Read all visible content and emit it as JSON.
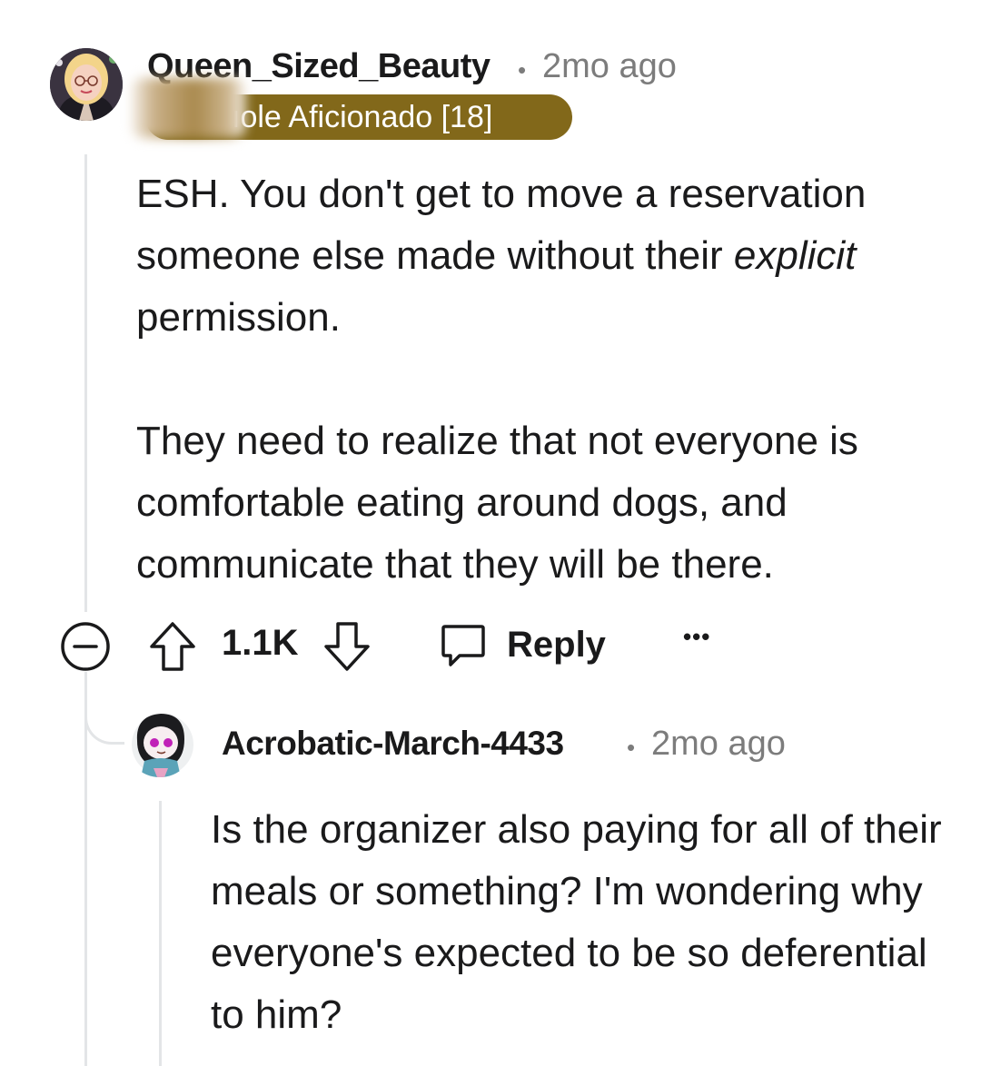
{
  "comments": [
    {
      "username": "Queen_Sized_Beauty",
      "separator": "•",
      "timestamp": "2mo ago",
      "flair": "ıole Aficionado [18]",
      "body": {
        "p1_a": "ESH. You don't get to move a reservation someone else made without their ",
        "p1_em": "explicit",
        "p1_b": " permission.",
        "p2": "They need to realize that not everyone is comfortable eating around dogs, and communicate that they will be there."
      },
      "actions": {
        "vote_count": "1.1K",
        "reply_label": "Reply",
        "more_label": "•••"
      }
    },
    {
      "username": "Acrobatic-March-4433",
      "separator": "•",
      "timestamp": "2mo ago",
      "body": {
        "p1": "Is the organizer also paying for all of their meals or something? I'm wondering why everyone's expected to be so deferential to him?"
      }
    }
  ],
  "icons": {
    "collapse": "collapse-icon",
    "upvote": "upvote-arrow-icon",
    "downvote": "downvote-arrow-icon",
    "reply": "chat-bubble-icon",
    "more": "more-options-icon"
  },
  "colors": {
    "flair_bg": "#82681a",
    "flair_text": "#ffffff",
    "meta_gray": "#7c7c7c",
    "thread_line": "#e3e5e7"
  }
}
